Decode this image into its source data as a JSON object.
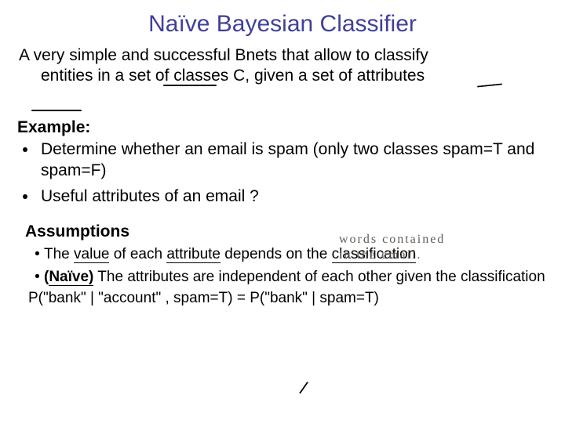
{
  "title": "Naïve Bayesian Classifier",
  "intro_line1": "A very simple and successful Bnets that allow to classify",
  "intro_line2_a": "entities in a set of ",
  "intro_line2_b": "classes",
  "intro_line2_c": "  C, given a set of ",
  "intro_line2_d": "attributes",
  "example_heading": "Example:",
  "bullet1": "Determine whether an email is spam (only two classes spam=T and spam=F)",
  "bullet2": "Useful attributes of an email ?",
  "handwritten1": "words contained",
  "handwritten2": "in the email.",
  "assumptions_heading": "Assumptions",
  "assumption1_a": "The ",
  "assumption1_b": "value",
  "assumption1_c": " of each ",
  "assumption1_d": "attribute",
  "assumption1_e": " depends on the ",
  "assumption1_f": "classification",
  "assumption2_a": "(",
  "assumption2_b": "Naïve)",
  "assumption2_c": " The attributes are independent of each other given the classification",
  "pline": "P(\"bank\" | \"account\" , spam=T) = P(\"bank\" | spam=T)"
}
